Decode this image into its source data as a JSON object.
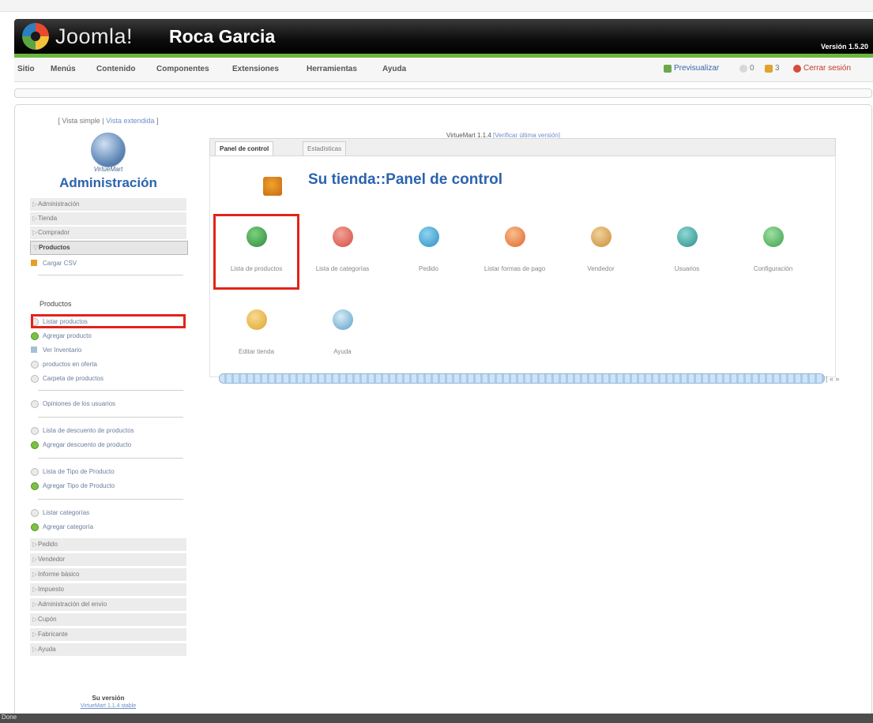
{
  "header": {
    "brand": "Joomla!",
    "site_name": "Roca Garcia",
    "version": "Versión 1.5.20"
  },
  "menu": {
    "items": [
      "Sitio",
      "Menús",
      "Contenido",
      "Componentes",
      "Extensiones",
      "Herramientas",
      "Ayuda"
    ],
    "right": {
      "preview": "Previsualizar",
      "messages": "0",
      "users": "3",
      "logout": "Cerrar sesión"
    }
  },
  "sidebar": {
    "view_simple": "[ Vista simple |",
    "view_extended": "Vista extendida",
    "view_close": "]",
    "logo_text": "VirtueMart",
    "title": "Administración",
    "sections_top": [
      "Administración",
      "Tienda",
      "Comprador"
    ],
    "expanded_section": "Productos",
    "csv_link": "Cargar CSV",
    "subheading": "Productos",
    "product_links": [
      "Listar productos",
      "Agregar producto",
      "Ver Inventario",
      "productos en oferta",
      "Carpeta de productos"
    ],
    "review_link": "Opiniones de los usuarios",
    "discount_links": [
      "Lista de descuento de productos",
      "Agregar descuento de producto"
    ],
    "type_links": [
      "Lista de Tipo de Producto",
      "Agregar Tipo de Producto"
    ],
    "category_links": [
      "Listar categorías",
      "Agregar categoría"
    ],
    "sections_bottom": [
      "Pedido",
      "Vendedor",
      "Informe básico",
      "Impuesto",
      "Administración del envío",
      "Cupón",
      "Fabricante",
      "Ayuda"
    ],
    "version_label": "Su versión",
    "version_value": "VirtueMart 1.1.4 stable"
  },
  "content": {
    "vm_version": "VirtueMart 1.1.4",
    "vm_version_link": "[Verificar última versión]",
    "tabs": [
      "Panel de control",
      "Estadísticas"
    ],
    "store_title": "Su tienda::Panel de control",
    "tiles": [
      {
        "label": "Lista de productos",
        "icon": "products-icon",
        "color": "#2f8a3a"
      },
      {
        "label": "Lista de categorías",
        "icon": "categories-icon",
        "color": "#d34b3c"
      },
      {
        "label": "Pedido",
        "icon": "orders-icon",
        "color": "#2b8fbf"
      },
      {
        "label": "Listar formas de pago",
        "icon": "payment-methods-icon",
        "color": "#e0642c"
      },
      {
        "label": "Vendedor",
        "icon": "vendor-icon",
        "color": "#c88c34"
      },
      {
        "label": "Usuarios",
        "icon": "users-icon",
        "color": "#2a8d8a"
      },
      {
        "label": "Configuración",
        "icon": "configuration-icon",
        "color": "#3c9e48"
      },
      {
        "label": "Editar tienda",
        "icon": "edit-store-icon",
        "color": "#e0a42a"
      },
      {
        "label": "Ayuda",
        "icon": "help-icon",
        "color": "#5a9fc7"
      }
    ],
    "pager": "| « »"
  },
  "status": "Done"
}
